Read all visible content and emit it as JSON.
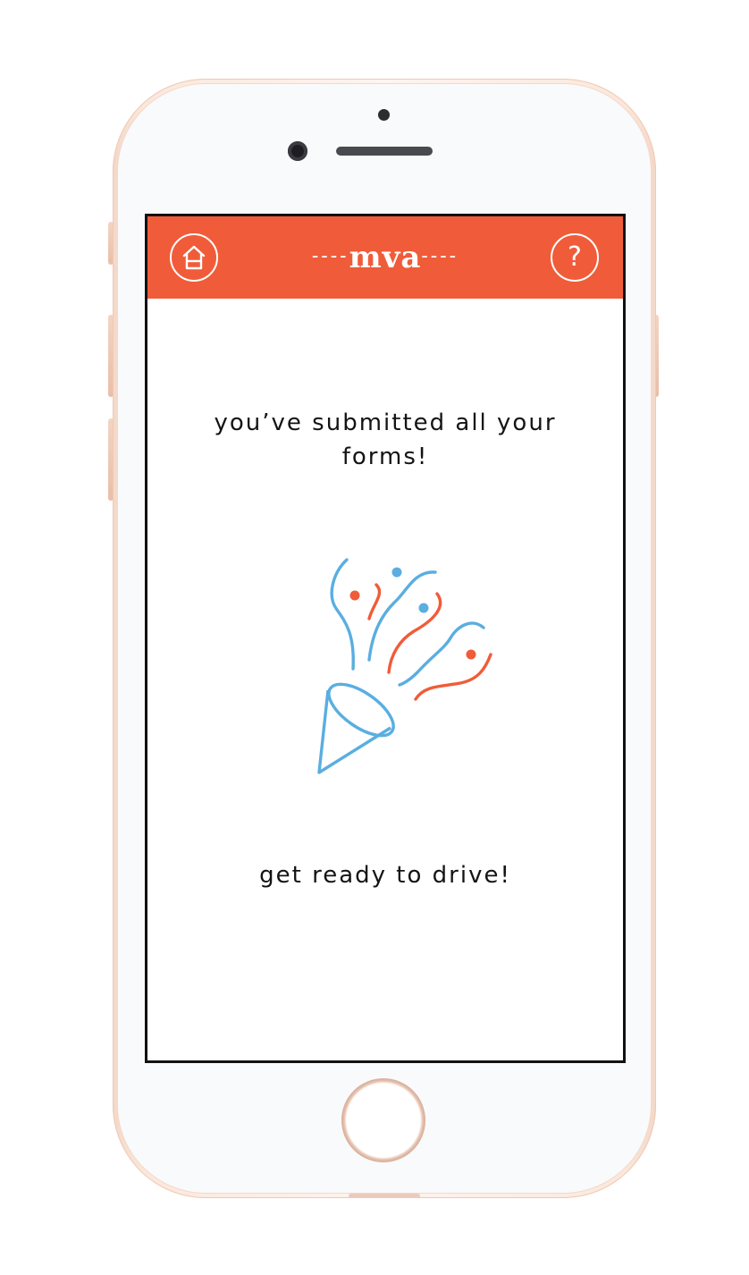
{
  "app": {
    "brand": "mva",
    "brand_dashes_left": "----",
    "brand_dashes_right": "----"
  },
  "header": {
    "home_icon": "home-icon",
    "help_icon": "help-icon",
    "help_glyph": "?"
  },
  "main": {
    "message_top": "you’ve submitted all your forms!",
    "message_bottom": "get ready to drive!",
    "illustration_icon": "party-popper-icon"
  },
  "colors": {
    "accent": "#f05c39",
    "illustration_blue": "#5aaee0",
    "illustration_red": "#f05c39",
    "text": "#141414"
  }
}
